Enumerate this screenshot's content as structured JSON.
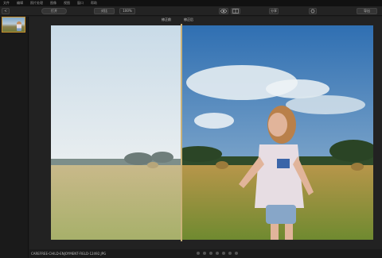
{
  "menu": [
    "文件",
    "编辑",
    "照片处理",
    "图像",
    "视图",
    "窗口",
    "帮助"
  ],
  "toolbar": {
    "back": "<",
    "open": "打开",
    "compare": "对比",
    "zoom": "100%",
    "share": "分享",
    "export": "导出"
  },
  "view": {
    "left_label": "修正前",
    "right_label": "修正后"
  },
  "status": {
    "filename": "CAREFREE-CHILD-ENJOYMENT-FIELD-12492.JPG"
  }
}
